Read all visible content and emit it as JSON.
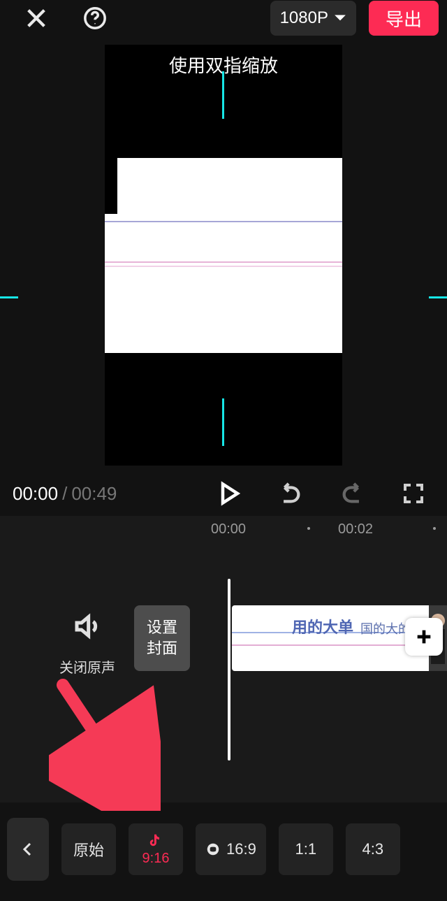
{
  "topbar": {
    "resolution": "1080P",
    "export_label": "导出"
  },
  "preview": {
    "pinch_hint": "使用双指缩放"
  },
  "playback": {
    "current": "00:00",
    "separator": "/",
    "total": "00:49"
  },
  "timeline": {
    "tick_labels": [
      "00:00",
      "00:02"
    ],
    "mute_label": "关闭原声",
    "cover_label_line1": "设置",
    "cover_label_line2": "封面",
    "clip_caption_bold": "用的大单",
    "clip_caption_tail": "国的大的单"
  },
  "ratio_bar": {
    "original_label": "原始",
    "ratio_9_16": "9:16",
    "ratio_16_9": "16:9",
    "ratio_1_1": "1:1",
    "ratio_4_3": "4:3"
  }
}
